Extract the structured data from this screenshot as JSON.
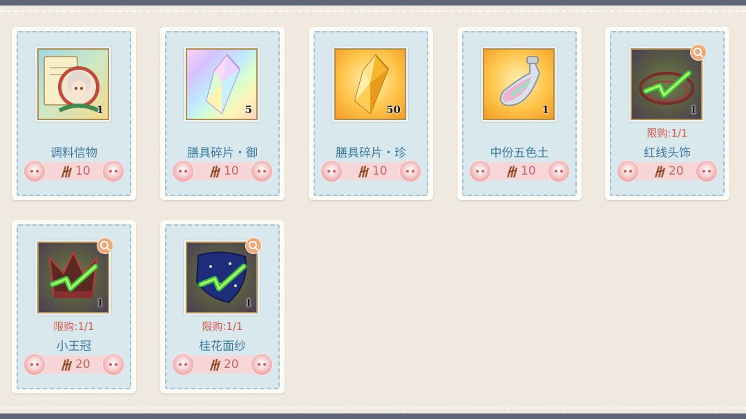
{
  "shop": {
    "items": [
      {
        "name": "调料信物",
        "quantity": "1",
        "price": "10",
        "limit": "",
        "art": "portrait-letter"
      },
      {
        "name": "膳具碎片・御",
        "quantity": "5",
        "price": "10",
        "limit": "",
        "art": "rainbow-crystal"
      },
      {
        "name": "膳具碎片・珍",
        "quantity": "50",
        "price": "10",
        "limit": "",
        "art": "gold-crystal"
      },
      {
        "name": "中份五色土",
        "quantity": "1",
        "price": "10",
        "limit": "",
        "art": "potion-bottle"
      },
      {
        "name": "红线头饰",
        "quantity": "1",
        "price": "20",
        "limit": "限购:1/1",
        "art": "red-thread-headwear"
      },
      {
        "name": "小王冠",
        "quantity": "1",
        "price": "20",
        "limit": "限购:1/1",
        "art": "small-crown"
      },
      {
        "name": "桂花面纱",
        "quantity": "1",
        "price": "20",
        "limit": "限购:1/1",
        "art": "veil"
      }
    ],
    "currency_icon": "bamboo-currency-icon",
    "colors": {
      "name_text": "#3c7ba0",
      "limit_text": "#d8574d",
      "price_text": "#c86464",
      "card_panel": "#d9e8ec",
      "background": "#efe9df"
    }
  }
}
